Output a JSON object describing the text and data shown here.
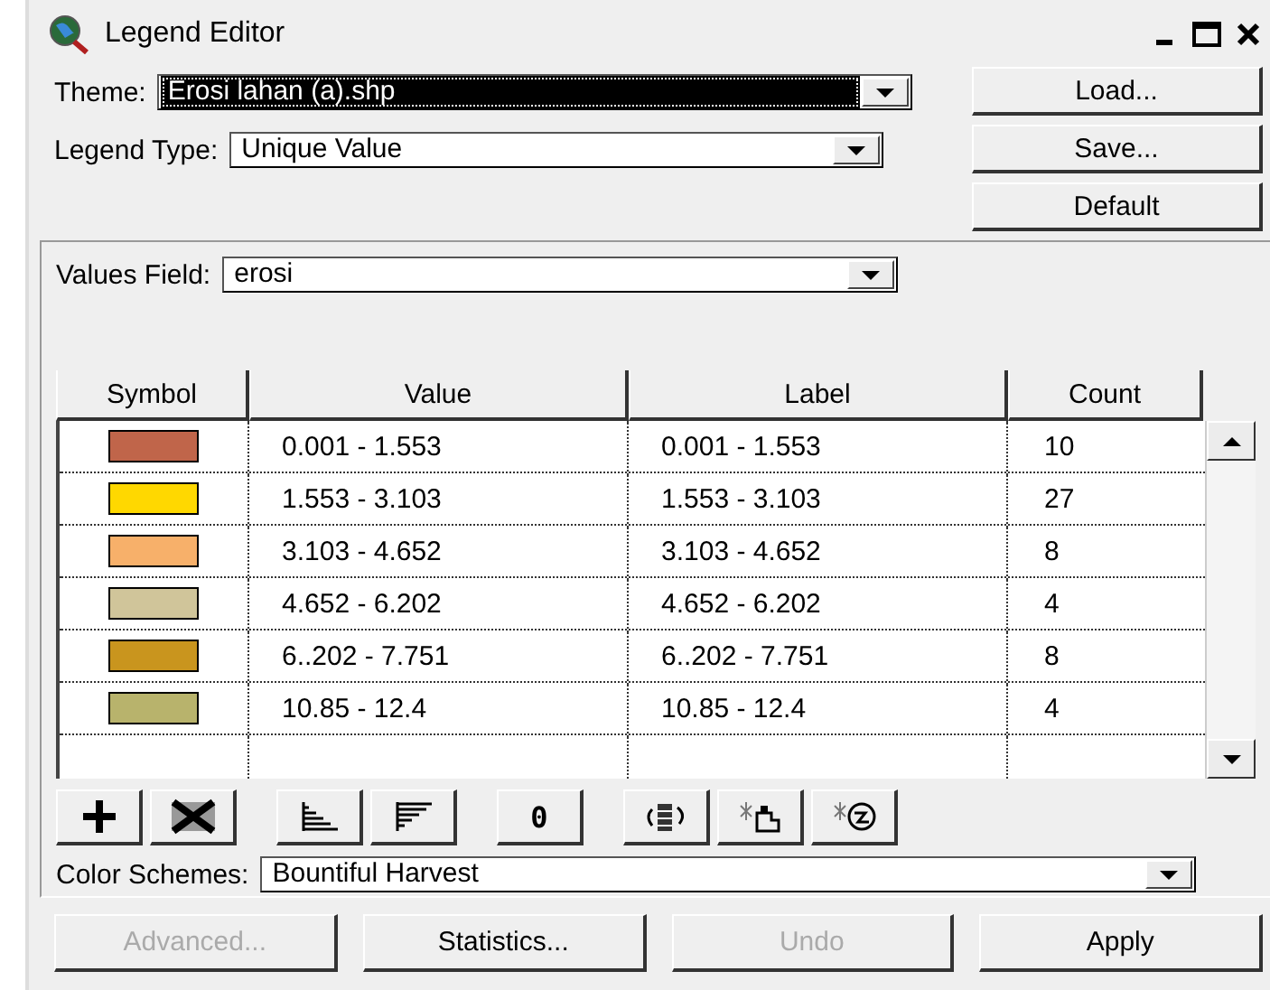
{
  "window": {
    "title": "Legend Editor"
  },
  "theme": {
    "label": "Theme:",
    "value": "Erosi lahan (a).shp",
    "selected": true
  },
  "legend_type": {
    "label": "Legend Type:",
    "value": "Unique Value",
    "selected": false
  },
  "side_buttons": [
    {
      "label": "Load..."
    },
    {
      "label": "Save..."
    },
    {
      "label": "Default"
    }
  ],
  "values_field": {
    "label": "Values Field:",
    "value": "erosi",
    "selected": false
  },
  "table": {
    "columns": [
      "Symbol",
      "Value",
      "Label",
      "Count"
    ],
    "rows": [
      {
        "color": "#c0654a",
        "value": "0.001 - 1.553",
        "label": "0.001 - 1.553",
        "count": "10"
      },
      {
        "color": "#ffd800",
        "value": "1.553 - 3.103",
        "label": "1.553 - 3.103",
        "count": "27"
      },
      {
        "color": "#f7b06a",
        "value": "3.103 - 4.652",
        "label": "3.103 - 4.652",
        "count": "8"
      },
      {
        "color": "#d0c59a",
        "value": "4.652 - 6.202",
        "label": "4.652 - 6.202",
        "count": "4"
      },
      {
        "color": "#c9951e",
        "value": "6..202 - 7.751",
        "label": "6..202 - 7.751",
        "count": "8"
      },
      {
        "color": "#b8b36c",
        "value": "10.85 - 12.4",
        "label": "10.85 - 12.4",
        "count": "4"
      }
    ]
  },
  "toolbar": [
    {
      "kind": "add"
    },
    {
      "kind": "delete"
    },
    {
      "kind": "sort_ascending"
    },
    {
      "kind": "sort_descending"
    },
    {
      "kind": "text",
      "text": "0"
    },
    {
      "kind": "flip"
    },
    {
      "kind": "remove"
    },
    {
      "kind": "reset"
    }
  ],
  "color_schemes": {
    "label": "Color Schemes:",
    "value": "Bountiful Harvest",
    "selected": false
  },
  "bottom_buttons": [
    {
      "label": "Advanced...",
      "disabled": true
    },
    {
      "label": "Statistics...",
      "disabled": false
    },
    {
      "label": "Undo",
      "disabled": true
    },
    {
      "label": "Apply",
      "disabled": false
    }
  ]
}
